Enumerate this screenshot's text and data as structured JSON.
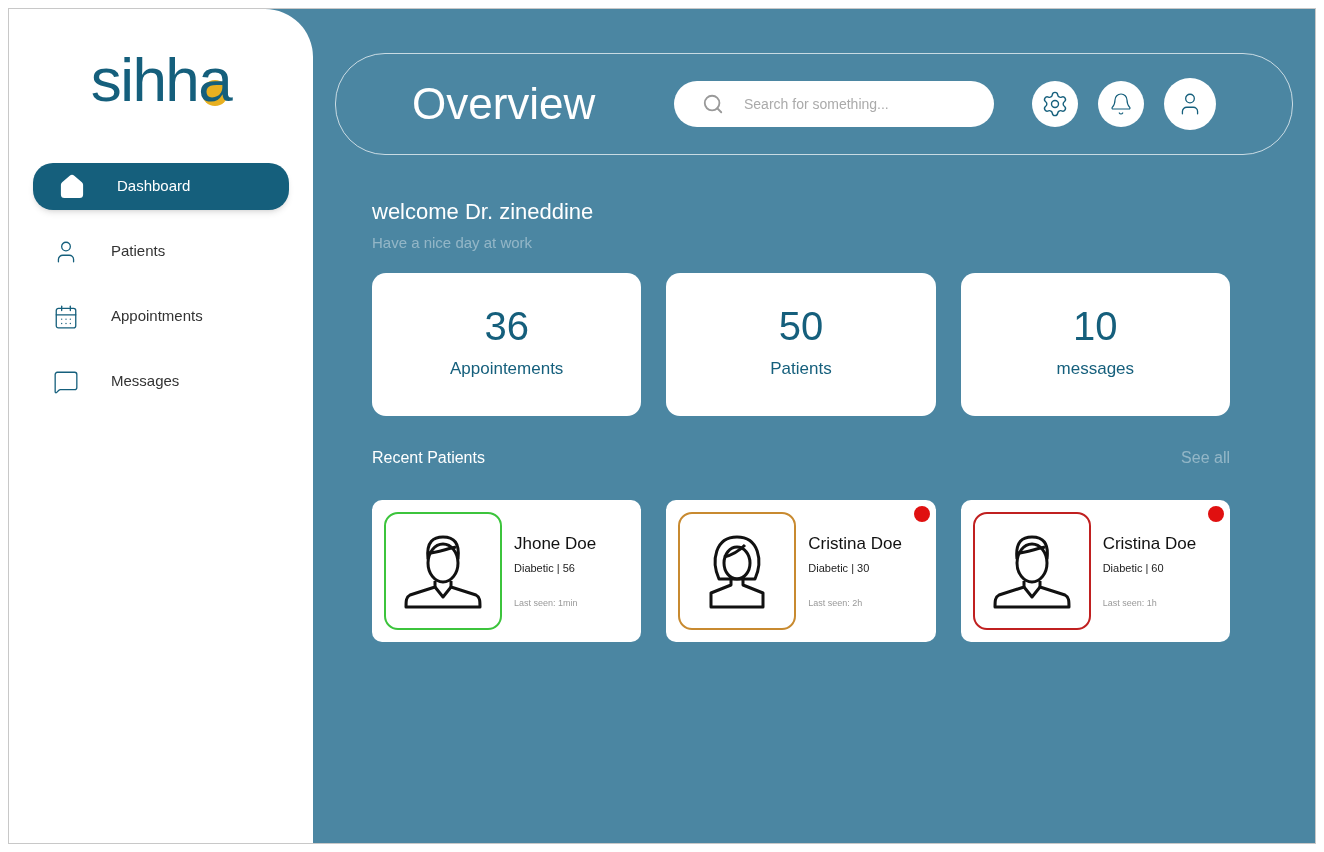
{
  "logo": {
    "text": "sihha"
  },
  "sidebar": {
    "items": [
      {
        "label": "Dashboard",
        "selected": true
      },
      {
        "label": "Patients",
        "selected": false
      },
      {
        "label": "Appointments",
        "selected": false
      },
      {
        "label": "Messages",
        "selected": false
      }
    ]
  },
  "header": {
    "title": "Overview",
    "search": {
      "placeholder": "Search for something..."
    }
  },
  "welcome": {
    "title": "welcome Dr. zineddine",
    "subtitle": "Have a nice day at work"
  },
  "stats": [
    {
      "value": "36",
      "label": "Appointements"
    },
    {
      "value": "50",
      "label": "Patients"
    },
    {
      "value": "10",
      "label": "messages"
    }
  ],
  "recent": {
    "title": "Recent Patients",
    "link": "See all",
    "patients": [
      {
        "name": "Jhone Doe",
        "info": "Diabetic | 56",
        "last_seen": "Last seen: 1min",
        "kind": "man",
        "color": "#3cc43c",
        "alert": false
      },
      {
        "name": "Cristina Doe",
        "info": "Diabetic | 30",
        "last_seen": "Last seen: 2h",
        "kind": "woman",
        "color": "#c88a30",
        "alert": true
      },
      {
        "name": "Cristina Doe",
        "info": "Diabetic | 60",
        "last_seen": "Last seen: 1h",
        "kind": "man",
        "color": "#c02020",
        "alert": true
      }
    ]
  }
}
